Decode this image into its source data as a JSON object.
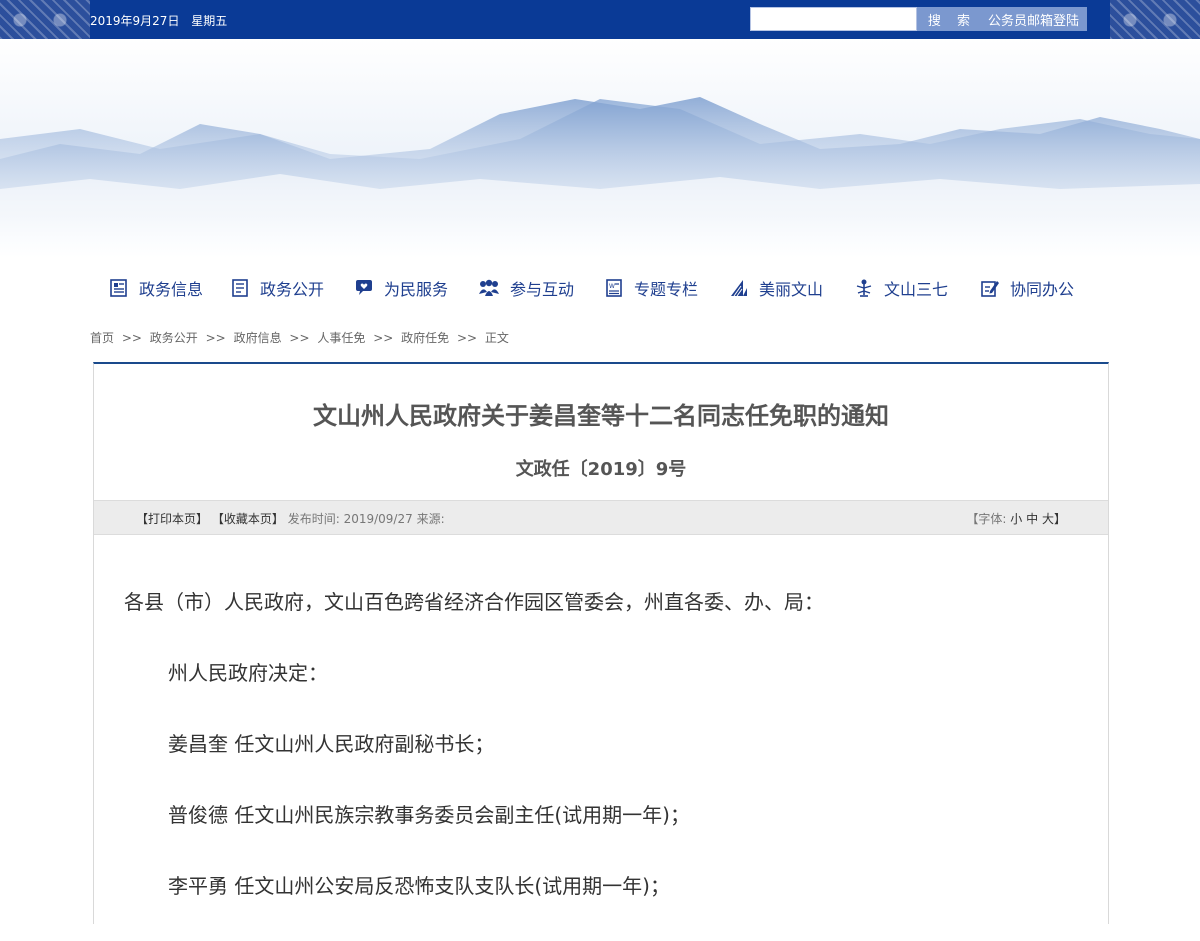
{
  "topbar": {
    "date": "2019年9月27日",
    "weekday": "星期五",
    "search_placeholder": "",
    "search_label": "搜 索",
    "mail_login_label": "公务员邮箱登陆"
  },
  "nav": {
    "items": [
      {
        "label": "政务信息",
        "icon": "document-list-icon"
      },
      {
        "label": "政务公开",
        "icon": "notepad-icon"
      },
      {
        "label": "为民服务",
        "icon": "speech-heart-icon"
      },
      {
        "label": "参与互动",
        "icon": "people-group-icon"
      },
      {
        "label": "专题专栏",
        "icon": "newspaper-icon"
      },
      {
        "label": "美丽文山",
        "icon": "mountain-peak-icon"
      },
      {
        "label": "文山三七",
        "icon": "sanqi-plant-icon"
      },
      {
        "label": "协同办公",
        "icon": "edit-form-icon"
      }
    ]
  },
  "breadcrumb": {
    "items": [
      "首页",
      "政务公开",
      "政府信息",
      "人事任免",
      "政府任免",
      "正文"
    ],
    "separator": ">>"
  },
  "article": {
    "title": "文山州人民政府关于姜昌奎等十二名同志任免职的通知",
    "doc_number": "文政任〔2019〕9号",
    "toolbar": {
      "print_label": "【打印本页】",
      "favorite_label": "【收藏本页】",
      "publish_label": "发布时间:",
      "publish_date": "2019/09/27",
      "source_label": "来源:",
      "font_label": "【字体:",
      "font_small": "小",
      "font_medium": "中",
      "font_large": "大】"
    },
    "paragraphs": [
      "各县（市）人民政府，文山百色跨省经济合作园区管委会，州直各委、办、局：",
      "州人民政府决定：",
      "姜昌奎  任文山州人民政府副秘书长；",
      "普俊德  任文山州民族宗教事务委员会副主任(试用期一年)；",
      "李平勇  任文山州公安局反恐怖支队支队长(试用期一年)；"
    ]
  },
  "colors": {
    "topbar_bg": "#0a3a96",
    "nav_text": "#1f3f8f",
    "button_bg": "#7b98cf",
    "title_text": "#555555"
  }
}
